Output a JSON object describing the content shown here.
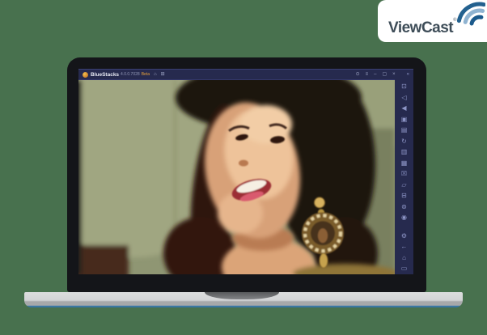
{
  "page": {
    "background_color": "#48714e"
  },
  "brand": {
    "name": "ViewCast",
    "registered_mark": "®",
    "text_color": "#3e4d58",
    "swoosh_colors": [
      "#1c5a8c",
      "#8fb3d1",
      "#23618f"
    ]
  },
  "laptop": {
    "window": {
      "title": "BlueStacks",
      "version": "4.0.0.7028",
      "beta_badge": "Beta",
      "titlebar_colors": {
        "background": "#262a4e",
        "beta_accent": "#e8a23c"
      },
      "titlebar_left_icons": [
        {
          "name": "home-icon",
          "glyph": "⌂"
        },
        {
          "name": "multi-window-icon",
          "glyph": "⊞"
        }
      ],
      "titlebar_right_icons": [
        {
          "name": "help-icon",
          "glyph": "⊙"
        },
        {
          "name": "menu-icon",
          "glyph": "≡"
        },
        {
          "name": "minimize-icon",
          "glyph": "–"
        },
        {
          "name": "maximize-icon",
          "glyph": "▢"
        },
        {
          "name": "close-icon",
          "glyph": "×"
        },
        {
          "name": "collapse-toolbar-icon",
          "glyph": "«"
        }
      ],
      "video": {
        "description": "Video frame: smiling young woman with dark hair and a gold chandelier earring against a blurred olive-green wall"
      },
      "toolbar": {
        "background": "#262a4e",
        "icon_color": "#8d95c6",
        "main_icons": [
          {
            "name": "fullscreen-icon",
            "glyph": "⊡"
          },
          {
            "name": "volume-up-icon",
            "glyph": "◁"
          },
          {
            "name": "volume-down-icon",
            "glyph": "◀"
          },
          {
            "name": "screenshot-icon",
            "glyph": "▣"
          },
          {
            "name": "camera-icon",
            "glyph": "▤"
          },
          {
            "name": "rotate-icon",
            "glyph": "↻"
          },
          {
            "name": "shake-icon",
            "glyph": "▥"
          },
          {
            "name": "keymap-icon",
            "glyph": "▦"
          },
          {
            "name": "close-app-icon",
            "glyph": "☒"
          },
          {
            "name": "folder-icon",
            "glyph": "▱"
          },
          {
            "name": "multi-instance-icon",
            "glyph": "⊟"
          },
          {
            "name": "boost-icon",
            "glyph": "⊚"
          },
          {
            "name": "location-icon",
            "glyph": "◉"
          }
        ],
        "nav_icons": [
          {
            "name": "settings-icon",
            "glyph": "⚙"
          },
          {
            "name": "back-icon",
            "glyph": "←"
          },
          {
            "name": "home-nav-icon",
            "glyph": "⌂"
          },
          {
            "name": "recents-icon",
            "glyph": "▭"
          }
        ]
      }
    },
    "base_colors": {
      "body": "#d3d4d6",
      "edge": "#a7a8aa",
      "underside_line": "#3e7ca8"
    }
  }
}
